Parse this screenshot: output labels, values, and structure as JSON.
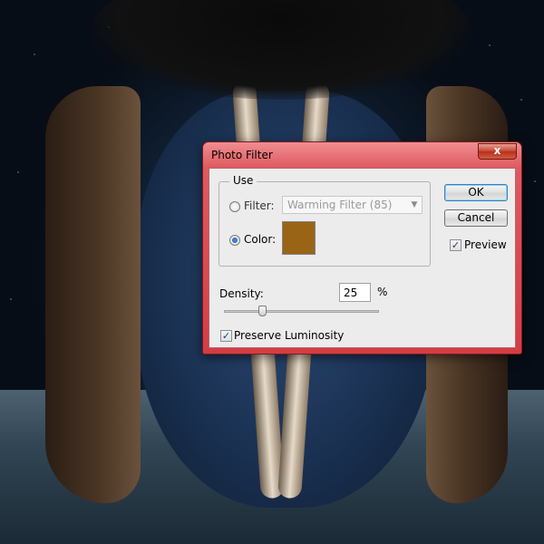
{
  "window": {
    "title": "Photo Filter",
    "close_glyph": "x"
  },
  "use_group": {
    "legend": "Use",
    "filter_label": "Filter:",
    "filter_value": "Warming Filter (85)",
    "filter_selected": false,
    "color_label": "Color:",
    "color_selected": true,
    "color_value": "#9a6417"
  },
  "buttons": {
    "ok": "OK",
    "cancel": "Cancel"
  },
  "preview": {
    "label": "Preview",
    "checked": true
  },
  "density": {
    "label": "Density:",
    "value": "25",
    "unit": "%",
    "level_percent": 25
  },
  "preserve_luminosity": {
    "label": "Preserve Luminosity",
    "checked": true
  },
  "icons": {
    "close": "close-icon",
    "dropdown": "chevron-down-icon",
    "check": "checkmark-icon"
  }
}
